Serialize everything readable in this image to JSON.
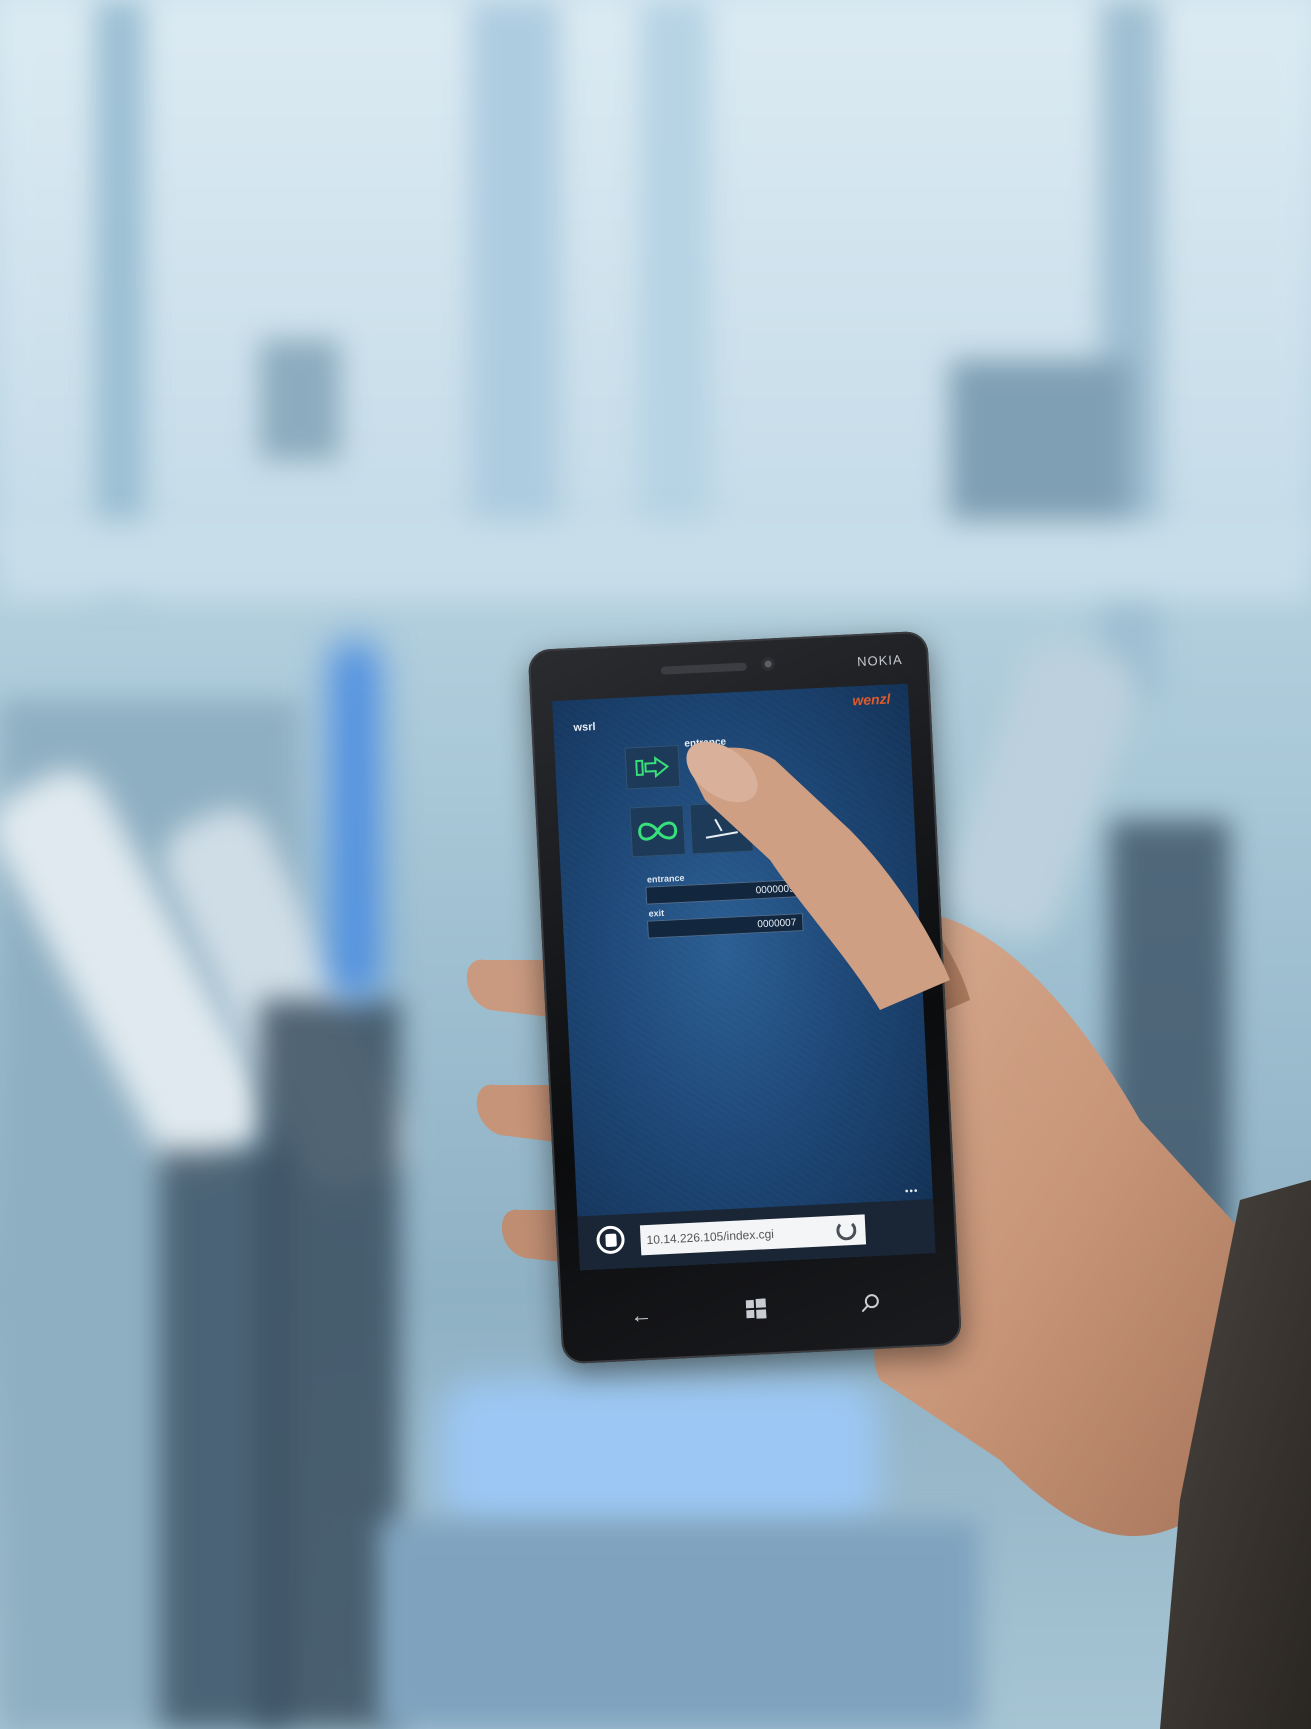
{
  "device": {
    "brand": "NOKIA"
  },
  "app": {
    "top_left_label": "wsrl",
    "logo_text": "wenzl",
    "tiles": {
      "entrance_label": "entrance"
    },
    "counters": [
      {
        "label": "entrance",
        "value": "0000009"
      },
      {
        "label": "exit",
        "value": "0000007"
      }
    ]
  },
  "browser": {
    "url": "10.14.226.105/index.cgi",
    "refresh_icon": "refresh-icon",
    "tabs_icon": "tabs-icon",
    "more_dots": "•••"
  },
  "system_nav": {
    "back_icon": "back-arrow-icon",
    "start_icon": "windows-icon",
    "search_icon": "search-icon"
  },
  "colors": {
    "accent_green": "#37e07a",
    "screen_blue": "#1f4a7a",
    "logo_orange": "#e05a2a"
  }
}
